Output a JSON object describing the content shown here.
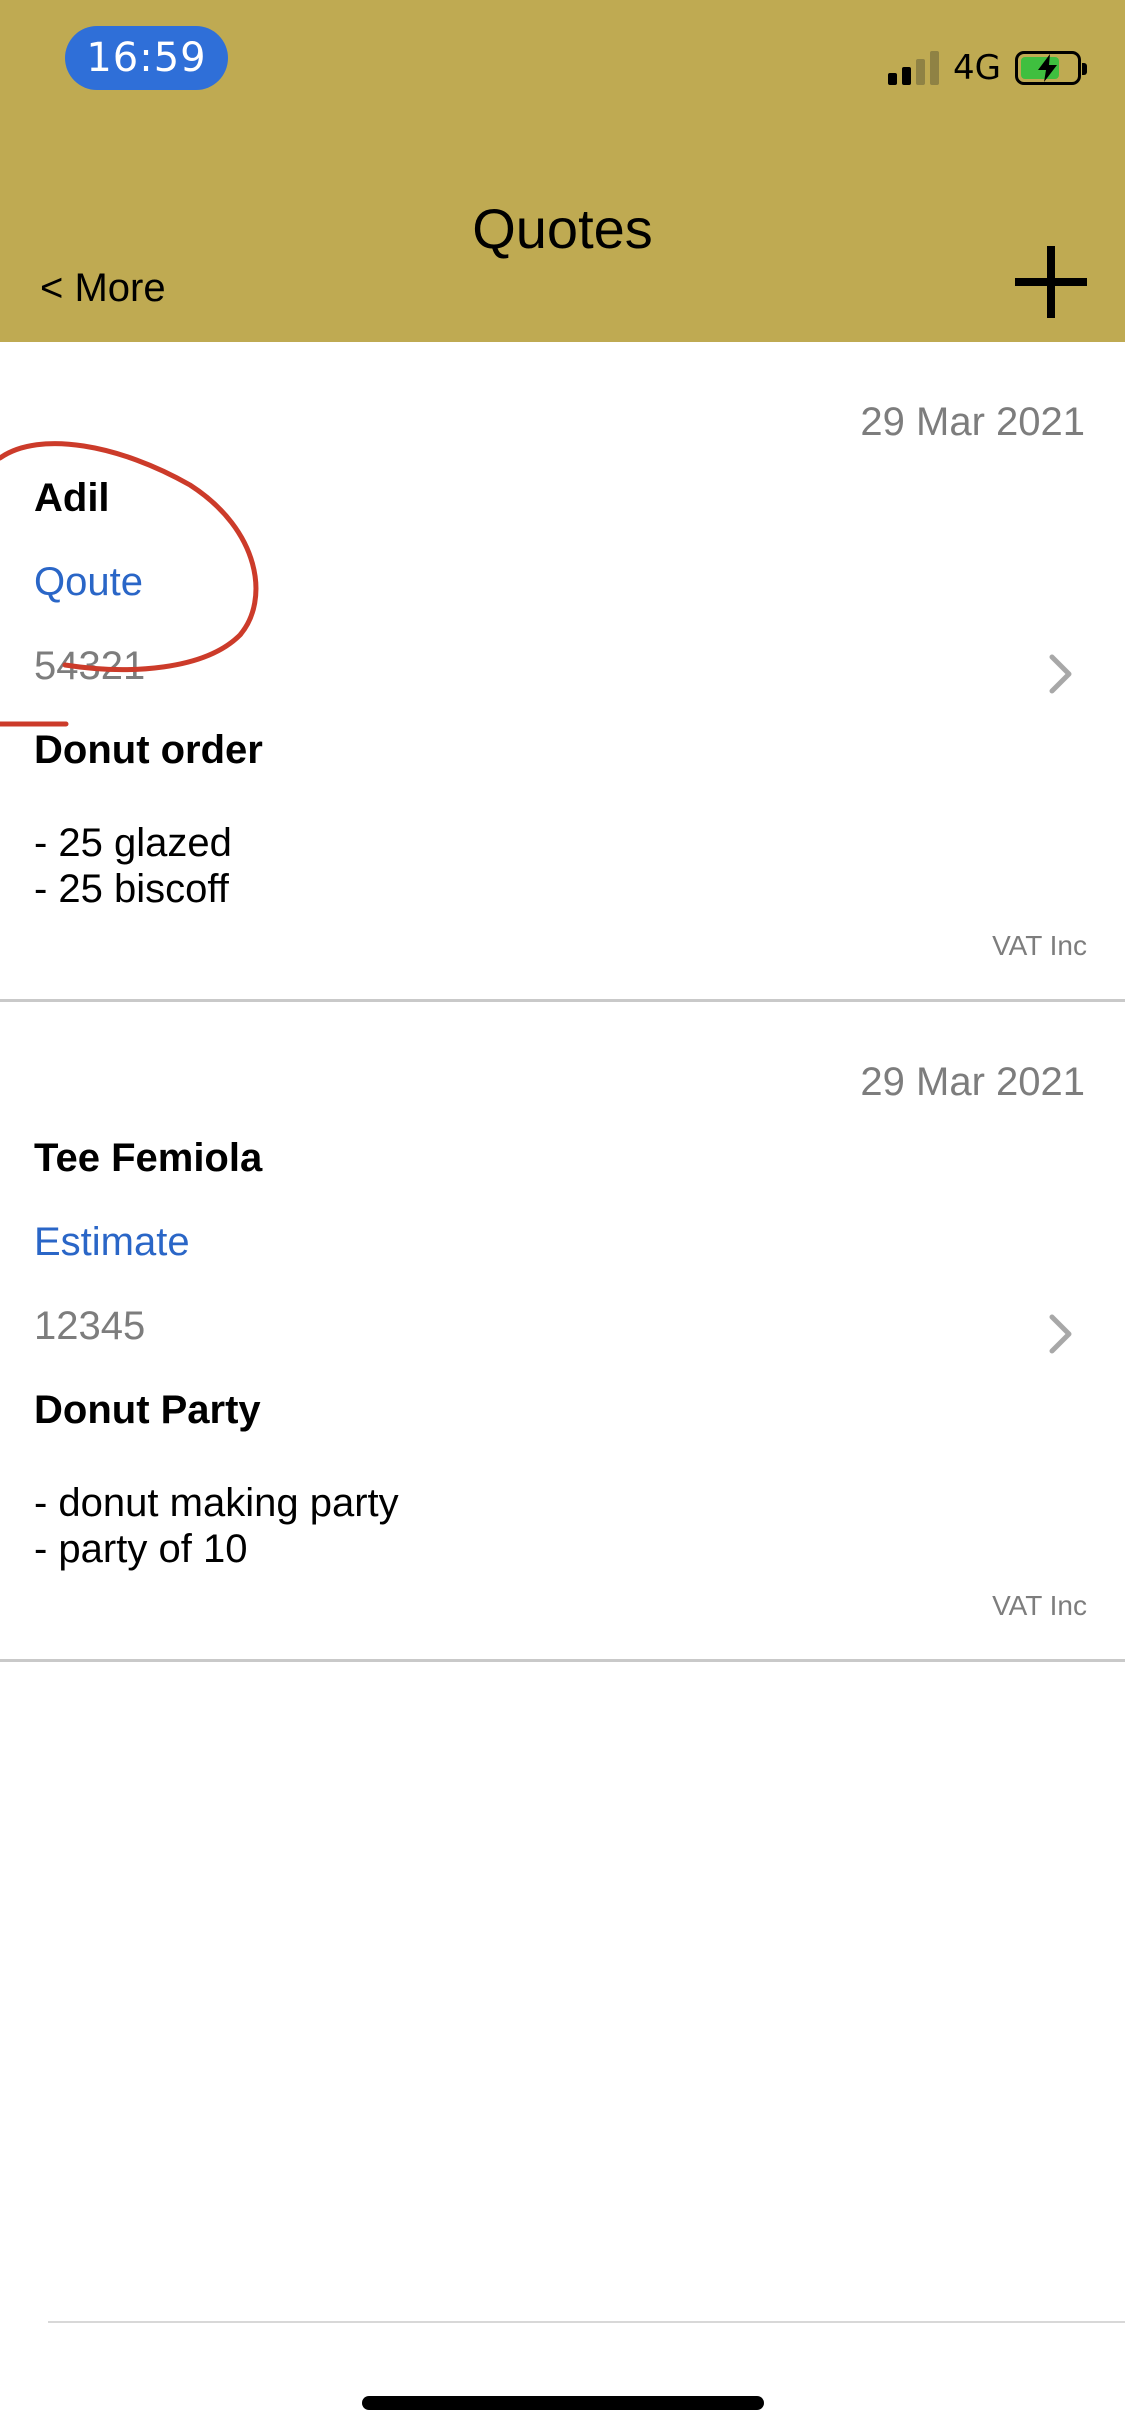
{
  "status_bar": {
    "time": "16:59",
    "network": "4G",
    "signal_bars_active": 2,
    "signal_bars_total": 4,
    "battery_charging": true,
    "battery_fill_fraction": 0.65
  },
  "nav": {
    "title": "Quotes",
    "back_label": "< More",
    "add_icon": "plus-icon"
  },
  "quotes": [
    {
      "date": "29 Mar 2021",
      "client": "Adil",
      "type": "Qoute",
      "number": "54321",
      "subject": "Donut order",
      "note_lines": [
        "- 25 glazed",
        "- 25 biscoff"
      ],
      "tax_label": "VAT Inc"
    },
    {
      "date": "29 Mar 2021",
      "client": "Tee Femiola",
      "type": "Estimate",
      "number": "12345",
      "subject": "Donut Party",
      "note_lines": [
        "- donut making party",
        "- party of 10"
      ],
      "tax_label": "VAT Inc"
    }
  ],
  "colors": {
    "header_bg": "#bfaa52",
    "time_pill": "#2f6fd8",
    "link_blue": "#2a66c7",
    "annotation_red": "#cc3b2a",
    "battery_green": "#3fbf3f"
  }
}
